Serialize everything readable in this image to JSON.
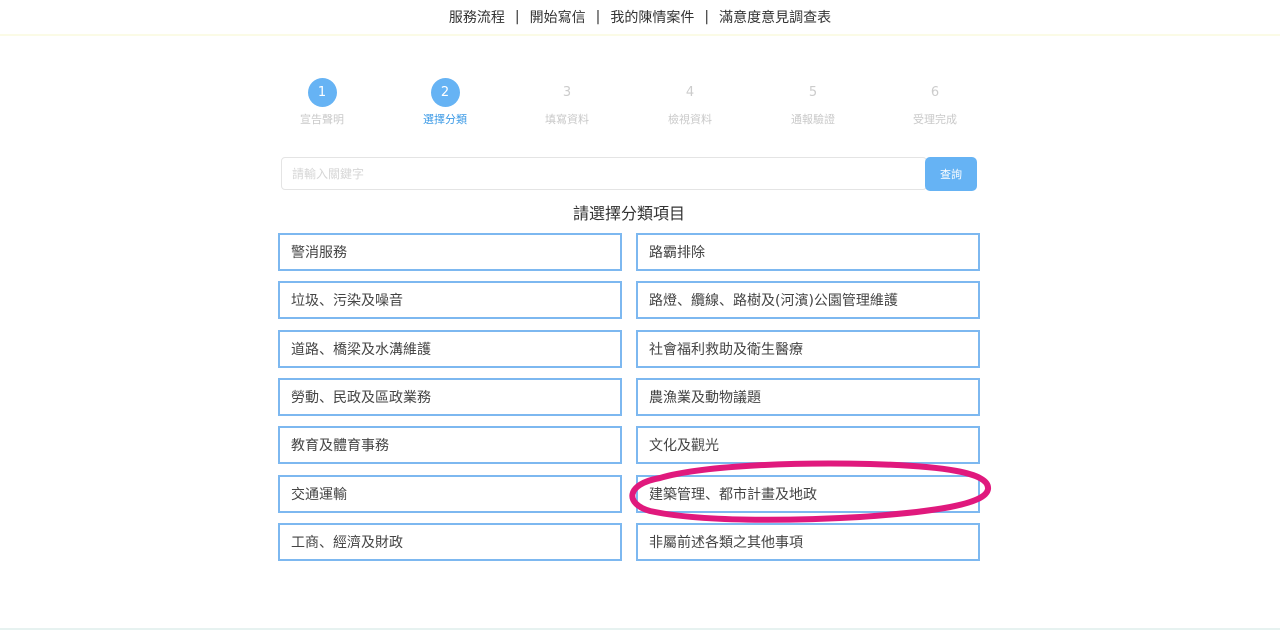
{
  "topnav": {
    "items": [
      "服務流程",
      "開始寫信",
      "我的陳情案件",
      "滿意度意見調查表"
    ],
    "separator": "|"
  },
  "steps": [
    {
      "number": "1",
      "label": "宣告聲明",
      "state": "done"
    },
    {
      "number": "2",
      "label": "選擇分類",
      "state": "current"
    },
    {
      "number": "3",
      "label": "填寫資料",
      "state": "pending"
    },
    {
      "number": "4",
      "label": "檢視資料",
      "state": "pending"
    },
    {
      "number": "5",
      "label": "通報驗證",
      "state": "pending"
    },
    {
      "number": "6",
      "label": "受理完成",
      "state": "pending"
    }
  ],
  "search": {
    "value": "",
    "placeholder": "請輸入關鍵字",
    "button_label": "查詢"
  },
  "section_title": "請選擇分類項目",
  "categories": [
    "警消服務",
    "路霸排除",
    "垃圾、污染及噪音",
    "路燈、纜線、路樹及(河濱)公園管理維護",
    "道路、橋梁及水溝維護",
    "社會福利救助及衛生醫療",
    "勞動、民政及區政業務",
    "農漁業及動物議題",
    "教育及體育事務",
    "文化及觀光",
    "交通運輸",
    "建築管理、都市計畫及地政",
    "工商、經濟及財政",
    "非屬前述各類之其他事項"
  ],
  "colors": {
    "accent": "#66b3f4",
    "border": "#7db8f0",
    "annotation": "#e0197d"
  }
}
